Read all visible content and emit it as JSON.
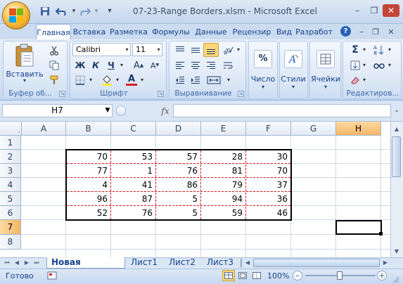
{
  "title_bar": {
    "title": "07-23-Range Borders.xlsm - Microsoft Excel",
    "qat": {
      "save_icon": "save-icon",
      "undo_icon": "undo-icon",
      "redo_icon": "redo-icon",
      "dropdown_glyph": "▾"
    },
    "window": {
      "minimize": "–",
      "restore": "❐",
      "close": "✕"
    }
  },
  "tabs": [
    "Главная",
    "Вставка",
    "Разметка",
    "Формулы",
    "Данные",
    "Рецензир",
    "Вид",
    "Разработ"
  ],
  "tab_right": {
    "help": "?",
    "minimize": "–",
    "restore": "❐",
    "close": "✕"
  },
  "ribbon": {
    "clipboard": {
      "paste_label": "Вставить",
      "group_label": "Буфер об..."
    },
    "font": {
      "name": "Calibri",
      "size": "11",
      "bold": "Ж",
      "italic": "К",
      "underline": "Ч",
      "grow": "A",
      "shrink": "A",
      "font_color_letter": "A",
      "group_label": "Шрифт",
      "underline_color": "#d62020"
    },
    "alignment": {
      "group_label": "Выравнивание"
    },
    "number": {
      "label": "Число",
      "icon": "%"
    },
    "styles": {
      "label": "Стили"
    },
    "cells": {
      "label": "Ячейки"
    },
    "editing": {
      "group_label": "Редактиров...",
      "sum": "Σ"
    }
  },
  "formula_bar": {
    "name_box": "H7",
    "fx": "fx",
    "value": ""
  },
  "columns": [
    "A",
    "B",
    "C",
    "D",
    "E",
    "F",
    "G",
    "H"
  ],
  "rows": [
    "1",
    "2",
    "3",
    "4",
    "5",
    "6",
    "7",
    "8"
  ],
  "cells": [
    [
      "70",
      "53",
      "57",
      "28",
      "30"
    ],
    [
      "77",
      "1",
      "76",
      "81",
      "70"
    ],
    [
      "4",
      "41",
      "86",
      "79",
      "37"
    ],
    [
      "96",
      "87",
      "5",
      "94",
      "36"
    ],
    [
      "52",
      "76",
      "5",
      "59",
      "46"
    ]
  ],
  "active_cell": "H7",
  "sheet_tabs": [
    "Новая таблица",
    "Лист1",
    "Лист2",
    "Лист3"
  ],
  "active_sheet": "Новая таблица",
  "status_bar": {
    "ready": "Готово",
    "zoom": "100%",
    "zoom_minus": "–",
    "zoom_plus": "+"
  },
  "colors": {
    "border_dash": "#e02020",
    "accent": "#15428b"
  }
}
